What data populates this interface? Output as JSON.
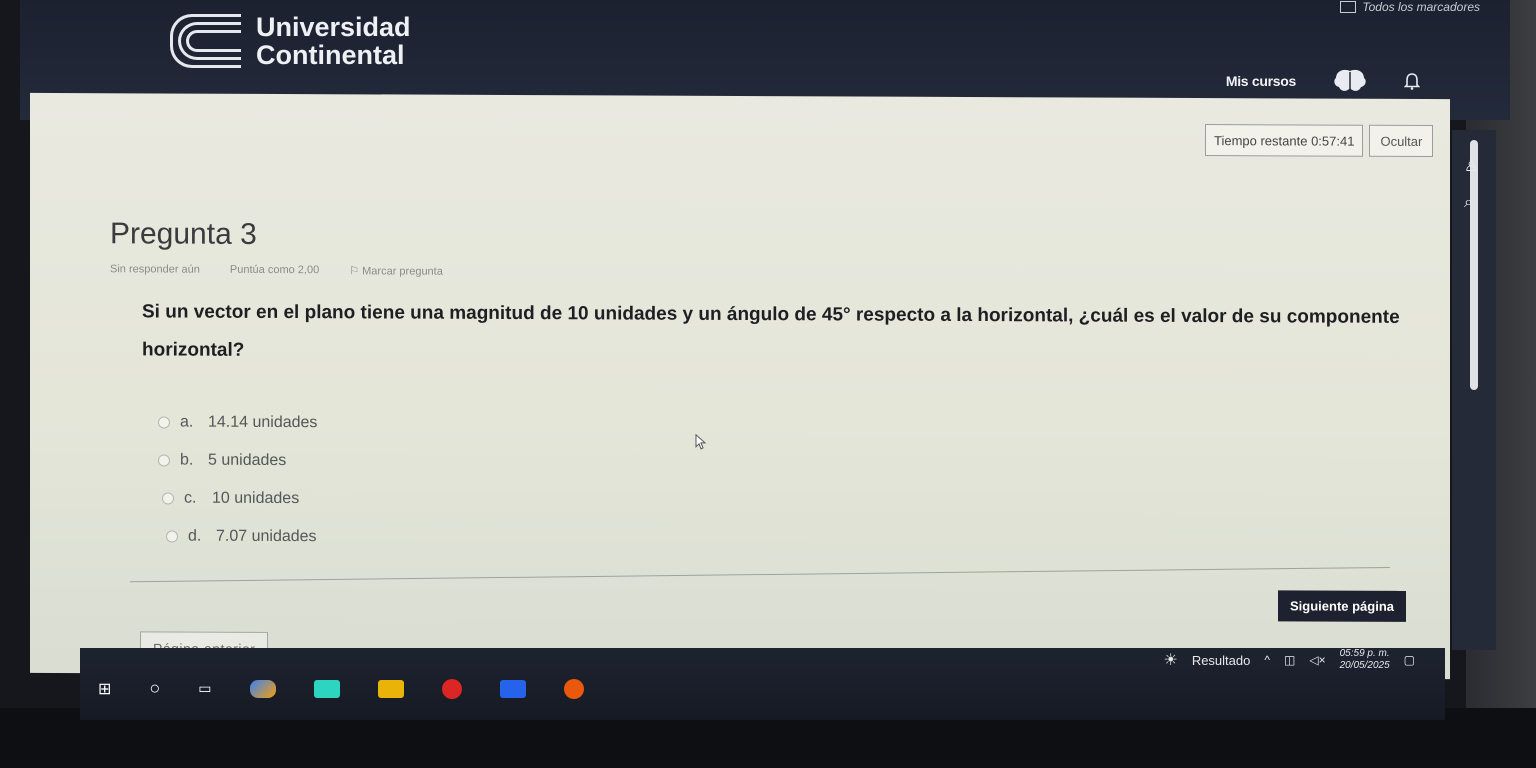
{
  "browser": {
    "bookmarks_label": "Todos los marcadores"
  },
  "header": {
    "logo_line1": "Universidad",
    "logo_line2": "Continental",
    "my_courses": "Mis cursos"
  },
  "timer": {
    "label": "Tiempo restante",
    "value": "0:57:41",
    "hide_label": "Ocultar"
  },
  "question": {
    "title": "Pregunta 3",
    "status": "Sin responder aún",
    "score": "Puntúa como 2,00",
    "flag_label": "Marcar pregunta",
    "text": "Si un vector en el plano tiene una magnitud de 10 unidades y un ángulo de 45° respecto a la horizontal, ¿cuál es el valor de su componente horizontal?",
    "answers": [
      {
        "letter": "a.",
        "text": "14.14 unidades"
      },
      {
        "letter": "b.",
        "text": "5 unidades"
      },
      {
        "letter": "c.",
        "text": "10 unidades"
      },
      {
        "letter": "d.",
        "text": "7.07 unidades"
      }
    ]
  },
  "nav": {
    "next_label": "Siguiente página",
    "prev_label": "Página anterior"
  },
  "taskbar": {
    "results_label": "Resultado",
    "time": "05:59 p. m.",
    "date": "20/05/2025"
  },
  "colors": {
    "header_bg": "#1c2130",
    "panel_bg": "#e9e9e0",
    "next_button_bg": "#1e2230"
  }
}
